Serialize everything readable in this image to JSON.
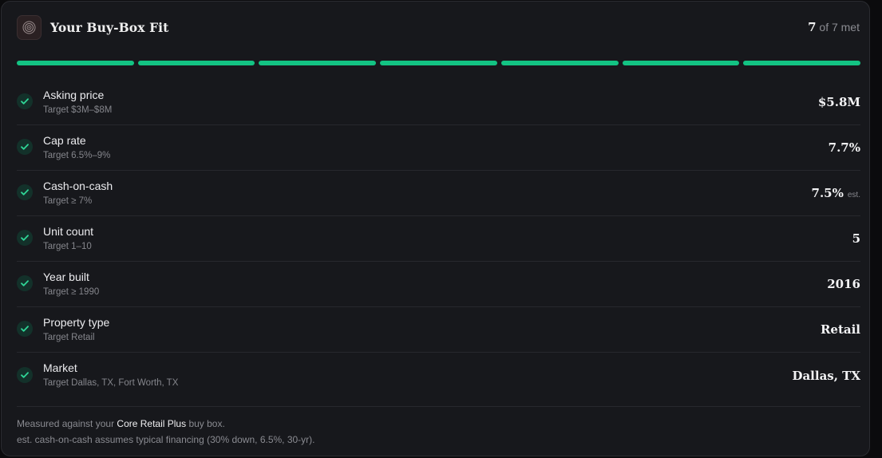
{
  "header": {
    "logo_icon": "target-rings-icon",
    "title": "Your Buy-Box Fit",
    "met_count": "7",
    "met_suffix": "of 7 met"
  },
  "progress": {
    "met": 7,
    "total": 7,
    "color_on": "#13c383",
    "color_off": "#3a3b40"
  },
  "criteria": [
    {
      "label": "Asking price",
      "target": "Target $3M–$8M",
      "value": "$5.8M",
      "note": "",
      "met": true
    },
    {
      "label": "Cap rate",
      "target": "Target 6.5%–9%",
      "value": "7.7%",
      "note": "",
      "met": true
    },
    {
      "label": "Cash-on-cash",
      "target": "Target ≥ 7%",
      "value": "7.5%",
      "note": "est.",
      "met": true
    },
    {
      "label": "Unit count",
      "target": "Target 1–10",
      "value": "5",
      "note": "",
      "met": true
    },
    {
      "label": "Year built",
      "target": "Target ≥ 1990",
      "value": "2016",
      "note": "",
      "met": true
    },
    {
      "label": "Property type",
      "target": "Target Retail",
      "value": "Retail",
      "note": "",
      "met": true
    },
    {
      "label": "Market",
      "target": "Target Dallas, TX, Fort Worth, TX",
      "value": "Dallas, TX",
      "note": "",
      "met": true
    }
  ],
  "footer": {
    "line1_prefix": "Measured against your ",
    "buy_box_name": "Core Retail Plus",
    "line1_suffix": " buy box.",
    "line2": "est. cash-on-cash assumes typical financing (30% down, 6.5%, 30-yr)."
  },
  "colors": {
    "accent": "#13c383",
    "check_bg": "#13312a"
  }
}
